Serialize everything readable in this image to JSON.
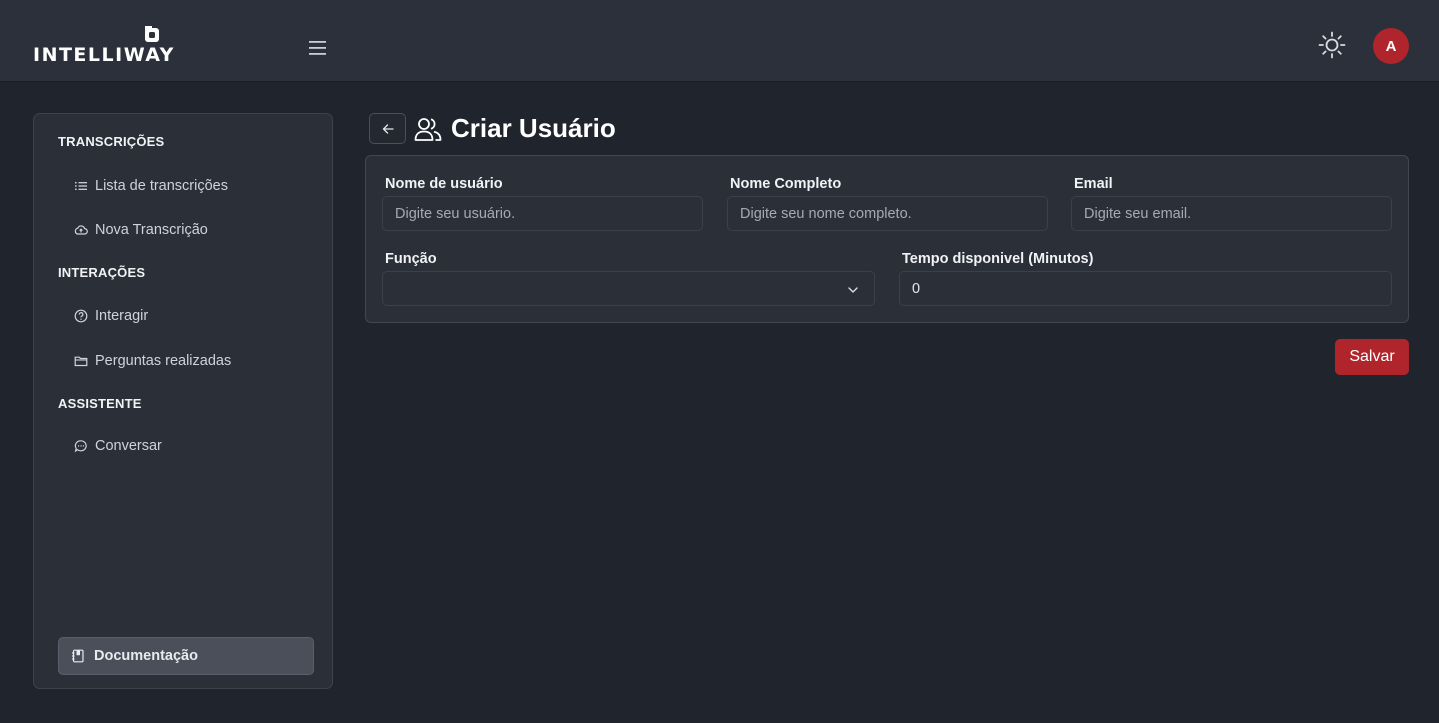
{
  "header": {
    "logo_text": "INTELLIWAY",
    "avatar_initial": "A"
  },
  "sidebar": {
    "sections": [
      {
        "title": "TRANSCRIÇÕES",
        "items": [
          {
            "label": "Lista de transcrições",
            "icon": "list-icon"
          },
          {
            "label": "Nova Transcrição",
            "icon": "cloud-upload-icon"
          }
        ]
      },
      {
        "title": "INTERAÇÕES",
        "items": [
          {
            "label": "Interagir",
            "icon": "help-circle-icon"
          },
          {
            "label": "Perguntas realizadas",
            "icon": "folder-icon"
          }
        ]
      },
      {
        "title": "ASSISTENTE",
        "items": [
          {
            "label": "Conversar",
            "icon": "chat-icon"
          }
        ]
      }
    ],
    "doc_button": "Documentação"
  },
  "page": {
    "title": "Criar Usuário"
  },
  "form": {
    "username": {
      "label": "Nome de usuário",
      "placeholder": "Digite seu usuário.",
      "value": ""
    },
    "fullname": {
      "label": "Nome Completo",
      "placeholder": "Digite seu nome completo.",
      "value": ""
    },
    "email": {
      "label": "Email",
      "placeholder": "Digite seu email.",
      "value": ""
    },
    "role": {
      "label": "Função",
      "value": ""
    },
    "time": {
      "label": "Tempo disponivel (Minutos)",
      "value": "0"
    }
  },
  "actions": {
    "save_label": "Salvar"
  },
  "colors": {
    "accent": "#b0252c",
    "background": "#20242c",
    "header": "#2b303a",
    "panel": "#2a2f38"
  }
}
